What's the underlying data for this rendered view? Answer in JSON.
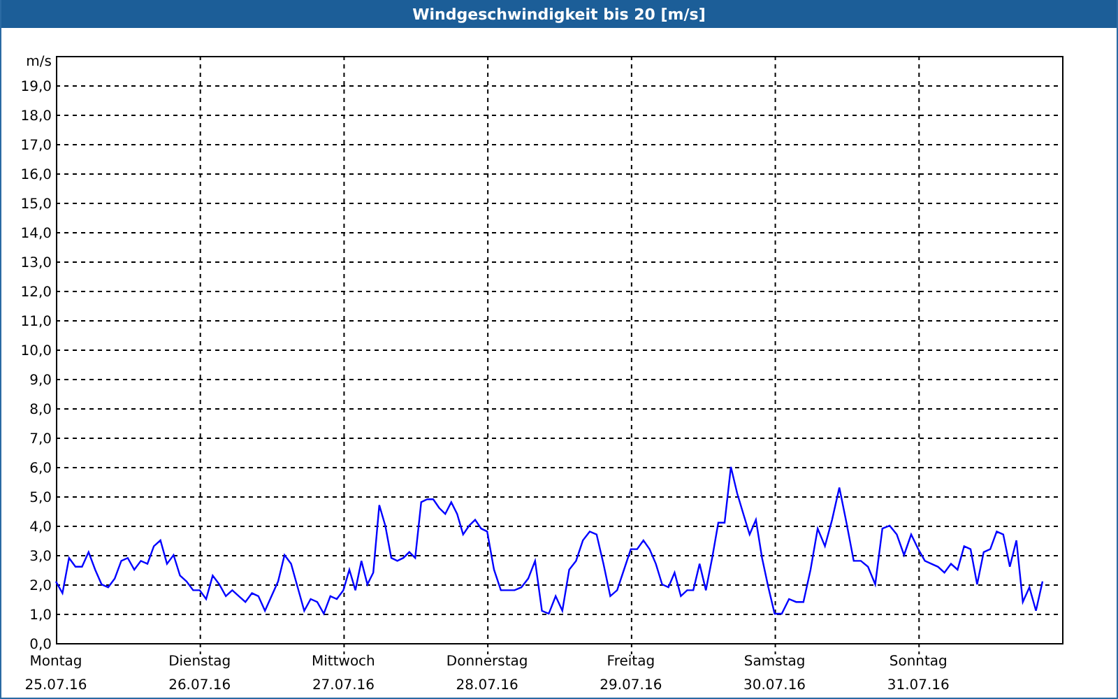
{
  "window": {
    "title": "Windgeschwindigkeit bis 20 [m/s]"
  },
  "chart": {
    "chart_data": {
      "type": "line",
      "grid": true,
      "ylabel": "m/s",
      "ylim": [
        0,
        20
      ],
      "categories": [
        "Montag",
        null,
        null,
        null,
        null,
        null,
        null,
        null,
        null,
        null,
        null,
        null,
        null,
        null,
        null,
        null,
        null,
        null,
        null,
        null,
        null,
        null,
        "Dienstag",
        null,
        null,
        null,
        null,
        null,
        null,
        null,
        null,
        null,
        null,
        null,
        null,
        null,
        null,
        null,
        null,
        null,
        null,
        null,
        null,
        null,
        "Mittwoch",
        null,
        null,
        null,
        null,
        null,
        null,
        null,
        null,
        null,
        null,
        null,
        null,
        null,
        null,
        null,
        null,
        null,
        null,
        null,
        null,
        null,
        null,
        null,
        "Donnerstag",
        null,
        null,
        null,
        null,
        null,
        null,
        null,
        null,
        null,
        null,
        null,
        null,
        null,
        null,
        null,
        null,
        null,
        null,
        null,
        null,
        "Freitag",
        null,
        null,
        null,
        null,
        null,
        null,
        null,
        null,
        null,
        null,
        null,
        null,
        null,
        null,
        null,
        null,
        null,
        null,
        null,
        null,
        null,
        null,
        "Samstag",
        null,
        null,
        null,
        null,
        null,
        null,
        null,
        null,
        null,
        null,
        null,
        null,
        null,
        null,
        null,
        null,
        null,
        null,
        null,
        "Sonntag",
        null,
        null,
        null,
        null,
        null,
        null,
        null,
        null,
        null,
        null,
        null,
        null,
        null,
        null,
        null,
        null,
        null,
        null,
        null
      ],
      "yticks": [
        {
          "value": 0,
          "label": "0,0"
        },
        {
          "value": 1,
          "label": "1,0"
        },
        {
          "value": 2,
          "label": "2,0"
        },
        {
          "value": 3,
          "label": "3,0"
        },
        {
          "value": 4,
          "label": "4,0"
        },
        {
          "value": 5,
          "label": "5,0"
        },
        {
          "value": 6,
          "label": "6,0"
        },
        {
          "value": 7,
          "label": "7,0"
        },
        {
          "value": 8,
          "label": "8,0"
        },
        {
          "value": 9,
          "label": "9,0"
        },
        {
          "value": 10,
          "label": "10,0"
        },
        {
          "value": 11,
          "label": "11,0"
        },
        {
          "value": 12,
          "label": "12,0"
        },
        {
          "value": 13,
          "label": "13,0"
        },
        {
          "value": 14,
          "label": "14,0"
        },
        {
          "value": 15,
          "label": "15,0"
        },
        {
          "value": 16,
          "label": "16,0"
        },
        {
          "value": 17,
          "label": "17,0"
        },
        {
          "value": 18,
          "label": "18,0"
        },
        {
          "value": 19,
          "label": "19,0"
        }
      ],
      "series": [
        {
          "color": "#0000ff",
          "values": [
            2.1,
            1.7,
            2.9,
            2.6,
            2.6,
            3.1,
            2.5,
            2.0,
            1.9,
            2.2,
            2.8,
            2.9,
            2.5,
            2.8,
            2.7,
            3.3,
            3.5,
            2.7,
            3.0,
            2.3,
            2.1,
            1.8,
            1.8,
            1.5,
            2.3,
            2.0,
            1.6,
            1.8,
            1.6,
            1.4,
            1.7,
            1.6,
            1.1,
            1.6,
            2.1,
            3.0,
            2.7,
            1.9,
            1.1,
            1.5,
            1.4,
            1.0,
            1.6,
            1.5,
            1.8,
            2.5,
            1.8,
            2.8,
            2.0,
            2.4,
            4.7,
            4.0,
            2.9,
            2.8,
            2.9,
            3.1,
            2.9,
            4.8,
            4.9,
            4.9,
            4.6,
            4.4,
            4.8,
            4.4,
            3.7,
            4.0,
            4.2,
            3.9,
            3.8,
            2.5,
            1.8,
            1.8,
            1.8,
            1.9,
            2.2,
            2.8,
            1.1,
            1.0,
            1.6,
            1.1,
            2.5,
            2.8,
            3.5,
            3.8,
            3.7,
            2.7,
            1.6,
            1.8,
            2.5,
            3.2,
            3.2,
            3.5,
            3.2,
            2.7,
            2.0,
            1.9,
            2.4,
            1.6,
            1.8,
            1.8,
            2.7,
            1.8,
            2.9,
            4.1,
            4.1,
            6.0,
            5.1,
            4.4,
            3.7,
            4.2,
            2.9,
            1.9,
            1.0,
            1.0,
            1.5,
            1.4,
            1.4,
            2.5,
            3.9,
            3.3,
            4.2,
            5.3,
            4.1,
            2.8,
            2.8,
            2.6,
            2.0,
            3.9,
            4.0,
            3.7,
            3.0,
            3.7,
            3.2,
            2.8,
            2.7,
            2.6,
            2.4,
            2.7,
            2.5,
            3.3,
            3.2,
            2.0,
            3.1,
            3.2,
            3.8,
            3.7,
            2.6,
            3.5,
            1.4,
            1.9,
            1.1,
            2.1
          ]
        }
      ]
    },
    "dates": [
      "25.07.16",
      "26.07.16",
      "27.07.16",
      "28.07.16",
      "29.07.16",
      "30.07.16",
      "31.07.16"
    ]
  }
}
